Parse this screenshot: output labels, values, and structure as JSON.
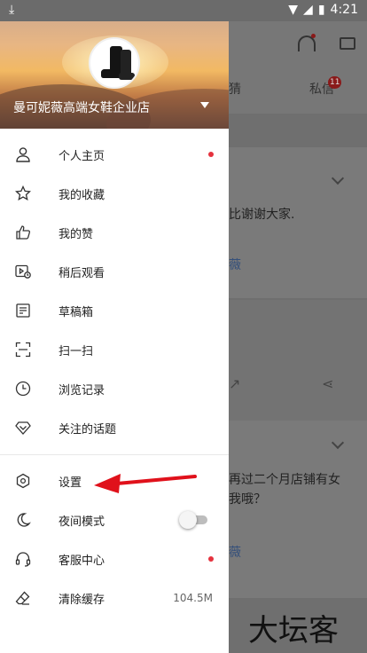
{
  "status_bar": {
    "download_icon": "download-icon",
    "time": "4:21"
  },
  "drawer": {
    "shop_name": "曼可妮薇高端女鞋企业店",
    "menu": [
      {
        "label": "个人主页",
        "icon": "person-icon",
        "red_dot": true
      },
      {
        "label": "我的收藏",
        "icon": "star-icon"
      },
      {
        "label": "我的赞",
        "icon": "thumb-up-icon"
      },
      {
        "label": "稍后观看",
        "icon": "watch-later-icon"
      },
      {
        "label": "草稿箱",
        "icon": "drafts-icon"
      },
      {
        "label": "扫一扫",
        "icon": "scan-icon"
      },
      {
        "label": "浏览记录",
        "icon": "clock-icon"
      },
      {
        "label": "关注的话题",
        "icon": "diamond-icon"
      }
    ],
    "menu2": [
      {
        "label": "设置",
        "icon": "settings-icon"
      },
      {
        "label": "夜间模式",
        "icon": "moon-icon",
        "toggle_on": false
      },
      {
        "label": "客服中心",
        "icon": "headset-icon",
        "red_dot": true
      },
      {
        "label": "清除缓存",
        "icon": "eraser-icon",
        "value": "104.5M"
      }
    ]
  },
  "background": {
    "tab_left": "猜",
    "tab_right": "私信",
    "badge": "11",
    "text1": "比谢谢大家.",
    "link1": "薇",
    "text2": "再过二个月店铺有女",
    "text3": "我哦？",
    "link2": "薇"
  },
  "watermark": "大坛客",
  "colors": {
    "accent_red": "#e5323e",
    "annotation_red": "#e0111b"
  }
}
